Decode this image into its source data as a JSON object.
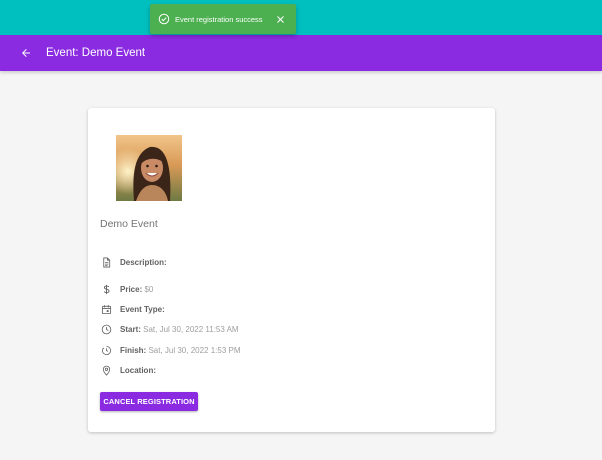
{
  "header": {
    "title": "Event: Demo Event",
    "colors": {
      "appbar": "#8a2be2",
      "top_strip": "#00bfbf"
    }
  },
  "toast": {
    "message": "Event registration success",
    "icon": "check-circle-icon",
    "close_icon": "close-icon",
    "color": "#4caf50"
  },
  "event": {
    "name": "Demo Event",
    "details": [
      {
        "label": "Description:",
        "value": "",
        "icon": "document-icon"
      },
      {
        "label": "Price:",
        "value": "$0",
        "icon": "dollar-icon"
      },
      {
        "label": "Event Type:",
        "value": "",
        "icon": "calendar-icon"
      },
      {
        "label": "Start:",
        "value": "Sat, Jul 30, 2022 11:53 AM",
        "icon": "clock-icon"
      },
      {
        "label": "Finish:",
        "value": "Sat, Jul 30, 2022 1:53 PM",
        "icon": "timer-icon"
      },
      {
        "label": "Location:",
        "value": "",
        "icon": "location-pin-icon"
      }
    ],
    "cancel_label": "CANCEL REGISTRATION"
  }
}
